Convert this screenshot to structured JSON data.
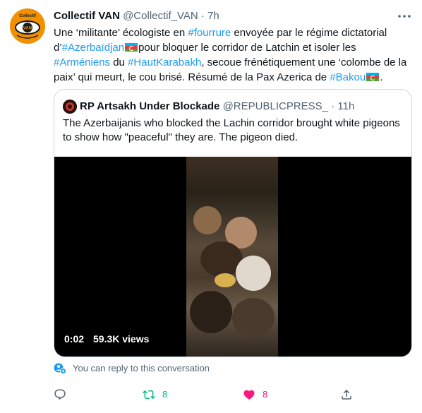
{
  "tweet": {
    "author_name": "Collectif VAN",
    "author_handle": "@Collectif_VAN",
    "separator": "·",
    "time": "7h",
    "avatar_text_top": "Collectif",
    "avatar_text_center": "VAN",
    "text": {
      "p1": "Une ‘militante’ écologiste en ",
      "tag_fourrure": "#fourrure",
      "p2": " envoyée par le régime dictatorial d’",
      "tag_azerbaidjan": "#Azerbaïdjan",
      "p3": "pour bloquer le corridor de Latchin et isoler les ",
      "tag_armeniens": "#Arméniens",
      "p4": " du ",
      "tag_hautkarabakh": "#HautKarabakh",
      "p5": ", secoue frénétiquement une ‘colombe de la paix’ qui meurt, le cou brisé. Résumé de la Pax Azerica de ",
      "tag_bakou": "#Bakou",
      "p6": "."
    }
  },
  "quoted": {
    "author_name": "RP Artsakh Under Blockade",
    "author_handle": "@REPUBLICPRESS_",
    "separator": "·",
    "time": "11h",
    "text": "The Azerbaijanis who blocked the Lachin corridor brought white pigeons to show how \"peaceful\" they are. The pigeon died.",
    "video": {
      "duration": "0:02",
      "views": "59.3K views"
    }
  },
  "reply_notice": "You can reply to this conversation",
  "actions": {
    "reply_count": "",
    "retweet_count": "8",
    "like_count": "8",
    "share_count": ""
  },
  "colors": {
    "link": "#1d9bf0",
    "retweet": "#00ba7c",
    "like": "#f91880",
    "secondary": "#536471"
  },
  "icons": [
    "more-icon",
    "reply-icon",
    "retweet-icon",
    "like-icon",
    "share-icon",
    "conversation-reply-icon",
    "azerbaijan-flag-icon"
  ]
}
